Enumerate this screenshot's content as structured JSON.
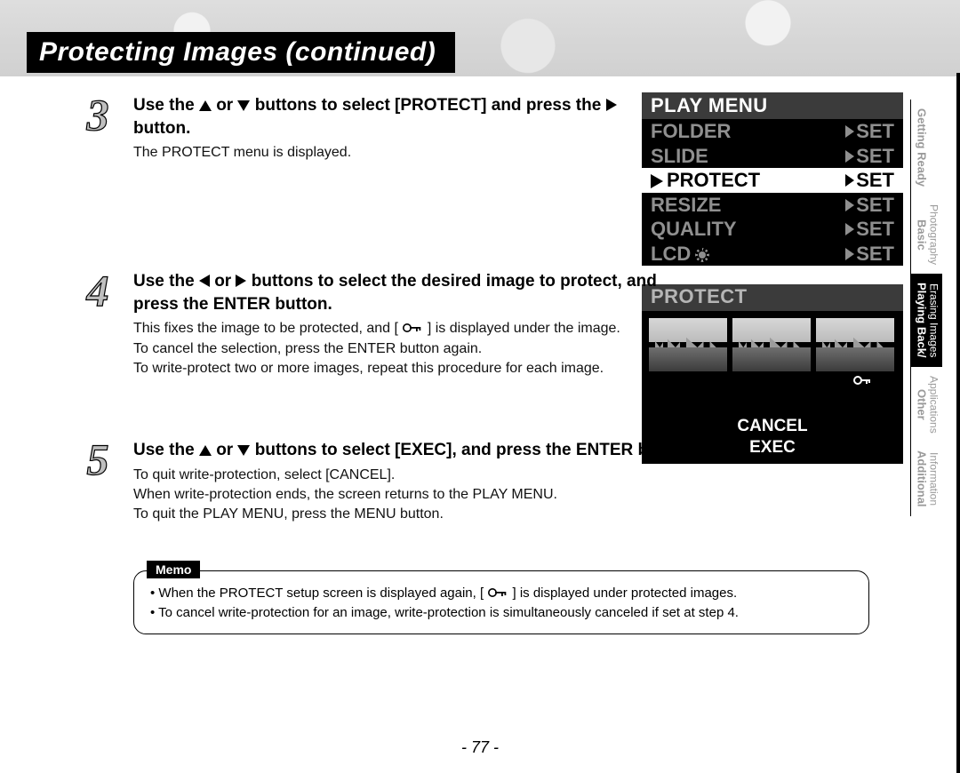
{
  "title": "Protecting Images (continued)",
  "page_number": "- 77 -",
  "side_tabs": [
    {
      "label": "Getting Ready"
    },
    {
      "label": "Basic",
      "sub": "Photography"
    },
    {
      "label": "Playing Back/",
      "sub": "Erasing Images",
      "active": true
    },
    {
      "label": "Other",
      "sub": "Applications"
    },
    {
      "label": "Additional",
      "sub": "Information"
    }
  ],
  "steps": {
    "s3": {
      "num": "3",
      "lead_a": "Use the ",
      "lead_b": " or ",
      "lead_c": " buttons to select [PROTECT] and press the ",
      "lead_d": " button.",
      "body": "The PROTECT menu is displayed."
    },
    "s4": {
      "num": "4",
      "lead_a": "Use the ",
      "lead_b": " or ",
      "lead_c": " buttons to select the desired image to protect, and press the ENTER button.",
      "body_a": "This fixes the image to be protected, and [ ",
      "body_b": " ] is displayed under the image.",
      "body_c": "To cancel the selection, press the ENTER button again.",
      "body_d": "To write-protect two or more images, repeat this procedure for each image."
    },
    "s5": {
      "num": "5",
      "lead_a": "Use the ",
      "lead_b": " or ",
      "lead_c": " buttons to select [EXEC], and press the ENTER button.",
      "body_a": "To quit write-protection, select [CANCEL].",
      "body_b": "When write-protection ends, the screen returns to the PLAY MENU.",
      "body_c": "To quit the PLAY MENU, press the MENU button."
    }
  },
  "play_menu": {
    "title": "PLAY MENU",
    "rows": [
      {
        "label": "FOLDER",
        "value": "SET"
      },
      {
        "label": "SLIDE",
        "value": "SET"
      },
      {
        "label": "PROTECT",
        "value": "SET",
        "selected": true
      },
      {
        "label": "RESIZE",
        "value": "SET"
      },
      {
        "label": "QUALITY",
        "value": "SET"
      },
      {
        "label": "LCD",
        "value": "SET",
        "icon": "sun"
      }
    ]
  },
  "protect_screen": {
    "title": "PROTECT",
    "cancel": "CANCEL",
    "exec": "EXEC"
  },
  "memo": {
    "label": "Memo",
    "item1_a": "When the PROTECT setup screen is displayed again, [ ",
    "item1_b": " ] is displayed under protected images.",
    "item2": "To cancel write-protection for an image, write-protection is simultaneously canceled if set at step 4."
  }
}
